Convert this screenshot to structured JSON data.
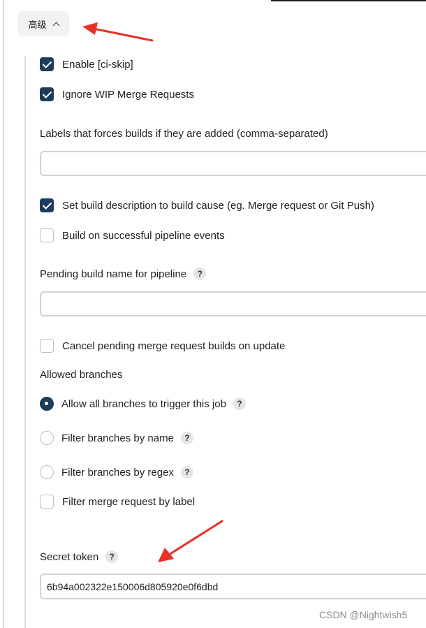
{
  "advanced_button": {
    "label": "高级"
  },
  "options": {
    "enable_ci_skip": {
      "label": "Enable [ci-skip]",
      "checked": true
    },
    "ignore_wip": {
      "label": "Ignore WIP Merge Requests",
      "checked": true
    },
    "labels_force_builds": {
      "label": "Labels that forces builds if they are added (comma-separated)",
      "value": ""
    },
    "set_build_description": {
      "label": "Set build description to build cause (eg. Merge request or Git Push)",
      "checked": true
    },
    "build_on_pipeline": {
      "label": "Build on successful pipeline events",
      "checked": false
    },
    "pending_build_name": {
      "label": "Pending build name for pipeline",
      "value": ""
    },
    "cancel_pending": {
      "label": "Cancel pending merge request builds on update",
      "checked": false
    }
  },
  "allowed_branches": {
    "heading": "Allowed branches",
    "choices": [
      {
        "label": "Allow all branches to trigger this job",
        "selected": true
      },
      {
        "label": "Filter branches by name",
        "selected": false
      },
      {
        "label": "Filter branches by regex",
        "selected": false
      }
    ],
    "filter_by_label": {
      "label": "Filter merge request by label",
      "checked": false
    }
  },
  "secret_token": {
    "label": "Secret token",
    "value": "6b94a002322e150006d805920e0f6dbd"
  },
  "help_glyph": "?",
  "watermark": "CSDN @Nightwish5",
  "colors": {
    "checked": "#1d3c5a",
    "annotation_arrow": "#e8302a",
    "border": "#ced3d8"
  }
}
